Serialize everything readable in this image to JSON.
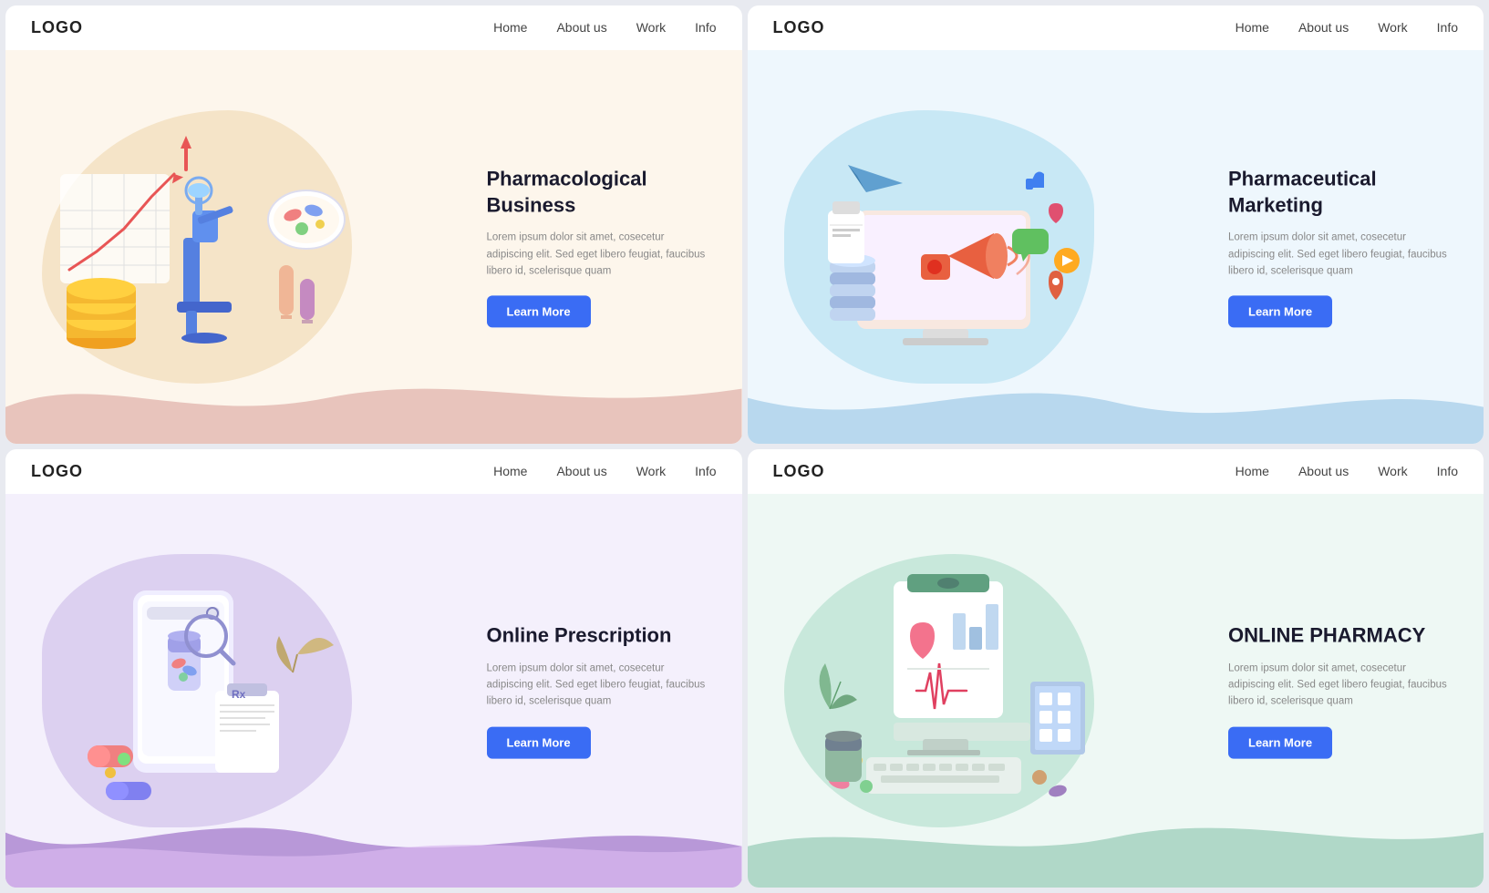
{
  "panels": [
    {
      "id": "panel-1",
      "logo": "LOGO",
      "nav": {
        "home": "Home",
        "about": "About us",
        "work": "Work",
        "info": "Info"
      },
      "title": "Pharmacological Business",
      "description": "Lorem ipsum dolor sit amet, cosecetur adipiscing elit. Sed eget libero feugiat, faucibus libero id, scelerisque quam",
      "button": "Learn More",
      "theme": "warm"
    },
    {
      "id": "panel-2",
      "logo": "LOGO",
      "nav": {
        "home": "Home",
        "about": "About us",
        "work": "Work",
        "info": "Info"
      },
      "title": "Pharmaceutical Marketing",
      "description": "Lorem ipsum dolor sit amet, cosecetur adipiscing elit. Sed eget libero feugiat, faucibus libero id, scelerisque quam",
      "button": "Learn More",
      "theme": "blue"
    },
    {
      "id": "panel-3",
      "logo": "LOGO",
      "nav": {
        "home": "Home",
        "about": "About us",
        "work": "Work",
        "info": "Info"
      },
      "title": "Online Prescription",
      "description": "Lorem ipsum dolor sit amet, cosecetur adipiscing elit. Sed eget libero feugiat, faucibus libero id, scelerisque quam",
      "button": "Learn More",
      "theme": "purple"
    },
    {
      "id": "panel-4",
      "logo": "LOGO",
      "nav": {
        "home": "Home",
        "about": "About us",
        "work": "Work",
        "info": "Info"
      },
      "title": "ONLINE PHARMACY",
      "description": "Lorem ipsum dolor sit amet, cosecetur adipiscing elit. Sed eget libero feugiat, faucibus libero id, scelerisque quam",
      "button": "Learn More",
      "theme": "green"
    }
  ]
}
